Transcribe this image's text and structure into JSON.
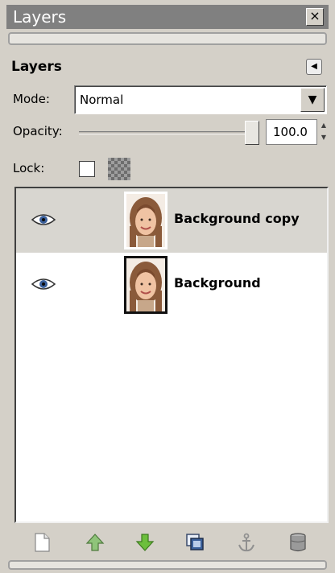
{
  "window": {
    "title": "Layers"
  },
  "panel": {
    "title": "Layers"
  },
  "mode": {
    "label": "Mode:",
    "value": "Normal"
  },
  "opacity": {
    "label": "Opacity:",
    "value": "100.0",
    "level": 1.0
  },
  "lock": {
    "label": "Lock:"
  },
  "layers": [
    {
      "name": "Background copy",
      "visible": true,
      "selected": true
    },
    {
      "name": "Background",
      "visible": true,
      "selected": false
    }
  ],
  "toolbar": {
    "icons": [
      "new-layer-icon",
      "raise-layer-icon",
      "lower-layer-icon",
      "duplicate-layer-icon",
      "anchor-layer-icon",
      "delete-layer-icon"
    ]
  },
  "colors": {
    "titlebar": "#808080",
    "selection": "#d8d6d0",
    "arrow_green": "#6cbf3c"
  }
}
